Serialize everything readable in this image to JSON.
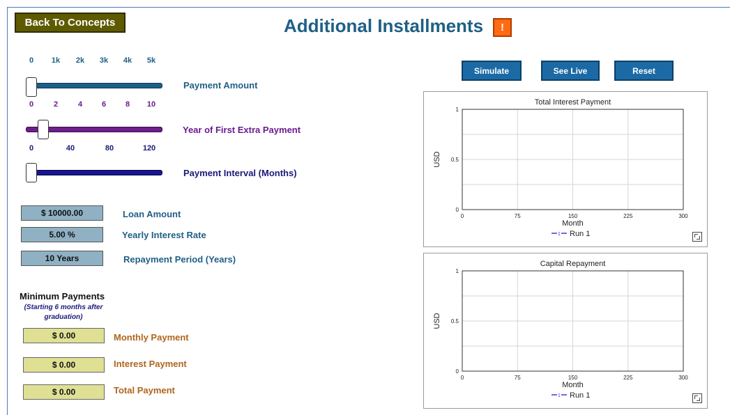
{
  "header": {
    "back_label": "Back To Concepts",
    "title": "Additional Installments",
    "alert_label": "!"
  },
  "sliders": [
    {
      "label": "Payment Amount",
      "ticks": [
        "0",
        "1k",
        "2k",
        "3k",
        "4k",
        "5k"
      ],
      "value": 0
    },
    {
      "label": "Year of First Extra Payment",
      "ticks": [
        "0",
        "2",
        "4",
        "6",
        "8",
        "10"
      ],
      "value": 1
    },
    {
      "label": "Payment Interval (Months)",
      "ticks": [
        "0",
        "40",
        "80",
        "120"
      ],
      "value": 0
    }
  ],
  "inputs": {
    "loan_amount": {
      "value": "$ 10000.00",
      "label": "Loan Amount"
    },
    "interest_rate": {
      "value": "5.00 %",
      "label": "Yearly Interest Rate"
    },
    "repayment_period": {
      "value": "10 Years",
      "label": "Repayment Period (Years)"
    }
  },
  "minimum": {
    "title": "Minimum Payments",
    "subtitle": "(Starting 6 months after graduation)",
    "monthly": {
      "value": "$ 0.00",
      "label": "Monthly Payment"
    },
    "interest": {
      "value": "$ 0.00",
      "label": "Interest Payment"
    },
    "total": {
      "value": "$ 0.00",
      "label": "Total Payment"
    }
  },
  "controls": {
    "simulate": "Simulate",
    "see_live": "See Live",
    "reset": "Reset"
  },
  "colors": {
    "series": "#3b3bd9"
  },
  "chart_data": [
    {
      "type": "line",
      "title": "Total Interest Payment",
      "xlabel": "Month",
      "ylabel": "USD",
      "xlim": [
        0,
        300
      ],
      "ylim": [
        0,
        1
      ],
      "x_ticks": [
        "0",
        "75",
        "150",
        "225",
        "300"
      ],
      "y_ticks": [
        "0",
        "0.5",
        "1"
      ],
      "grid": true,
      "legend_position": "bottom",
      "series": [
        {
          "name": "Run 1",
          "marker": "1",
          "x": [],
          "y": []
        }
      ]
    },
    {
      "type": "line",
      "title": "Capital Repayment",
      "xlabel": "Month",
      "ylabel": "USD",
      "xlim": [
        0,
        300
      ],
      "ylim": [
        0,
        1
      ],
      "x_ticks": [
        "0",
        "75",
        "150",
        "225",
        "300"
      ],
      "y_ticks": [
        "0",
        "0.5",
        "1"
      ],
      "grid": true,
      "legend_position": "bottom",
      "series": [
        {
          "name": "Run 1",
          "marker": "1",
          "x": [],
          "y": []
        }
      ]
    }
  ]
}
